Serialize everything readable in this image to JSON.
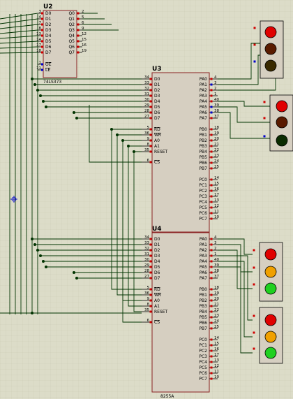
{
  "colors": {
    "background": "#dcdcc8",
    "grid": "#c9c9b3",
    "chip_fill": "#d6cfc1",
    "chip_border": "#8a2222",
    "wire": "#003300",
    "junction": "#003300",
    "pin_red": "#d00000",
    "pin_blue": "#0000cc",
    "led_red": "#e00000",
    "led_dark_red": "#5a1a00",
    "led_dark": "#3a2a00",
    "led_dark_green": "#0a2a00",
    "led_amber": "#f0a000",
    "led_green": "#20d020"
  },
  "components": {
    "u2": {
      "ref": "U2",
      "part": "74LS373",
      "left_pins": [
        {
          "num": "3",
          "name": "D0"
        },
        {
          "num": "4",
          "name": "D1"
        },
        {
          "num": "7",
          "name": "D2"
        },
        {
          "num": "8",
          "name": "D3"
        },
        {
          "num": "13",
          "name": "D4"
        },
        {
          "num": "14",
          "name": "D5"
        },
        {
          "num": "17",
          "name": "D6"
        },
        {
          "num": "18",
          "name": "D7"
        }
      ],
      "ctrl_pins": [
        {
          "num": "1",
          "name": "OE"
        },
        {
          "num": "11",
          "name": "LE"
        }
      ],
      "right_pins": [
        {
          "num": "2",
          "name": "Q0"
        },
        {
          "num": "5",
          "name": "Q1"
        },
        {
          "num": "6",
          "name": "Q2"
        },
        {
          "num": "9",
          "name": "Q3"
        },
        {
          "num": "12",
          "name": "Q4"
        },
        {
          "num": "15",
          "name": "Q5"
        },
        {
          "num": "16",
          "name": "Q6"
        },
        {
          "num": "19",
          "name": "Q7"
        }
      ]
    },
    "u3": {
      "ref": "U3",
      "part": "",
      "left_pins": [
        {
          "num": "34",
          "name": "D0"
        },
        {
          "num": "33",
          "name": "D1"
        },
        {
          "num": "32",
          "name": "D2"
        },
        {
          "num": "31",
          "name": "D3"
        },
        {
          "num": "30",
          "name": "D4"
        },
        {
          "num": "29",
          "name": "D5"
        },
        {
          "num": "28",
          "name": "D6"
        },
        {
          "num": "27",
          "name": "D7"
        }
      ],
      "ctrl_pins": [
        {
          "num": "5",
          "name": "RD"
        },
        {
          "num": "36",
          "name": "WR"
        },
        {
          "num": "9",
          "name": "A0"
        },
        {
          "num": "8",
          "name": "A1"
        },
        {
          "num": "35",
          "name": "RESET"
        }
      ],
      "cs_pin": {
        "num": "6",
        "name": "CS"
      },
      "pa": [
        {
          "num": "4",
          "name": "PA0"
        },
        {
          "num": "3",
          "name": "PA1"
        },
        {
          "num": "2",
          "name": "PA2"
        },
        {
          "num": "1",
          "name": "PA3"
        },
        {
          "num": "40",
          "name": "PA4"
        },
        {
          "num": "39",
          "name": "PA5"
        },
        {
          "num": "38",
          "name": "PA6"
        },
        {
          "num": "37",
          "name": "PA7"
        }
      ],
      "pb": [
        {
          "num": "18",
          "name": "PB0"
        },
        {
          "num": "19",
          "name": "PB1"
        },
        {
          "num": "20",
          "name": "PB2"
        },
        {
          "num": "21",
          "name": "PB3"
        },
        {
          "num": "22",
          "name": "PB4"
        },
        {
          "num": "23",
          "name": "PB5"
        },
        {
          "num": "24",
          "name": "PB6"
        },
        {
          "num": "25",
          "name": "PB7"
        }
      ],
      "pc": [
        {
          "num": "14",
          "name": "PC0"
        },
        {
          "num": "15",
          "name": "PC1"
        },
        {
          "num": "16",
          "name": "PC2"
        },
        {
          "num": "17",
          "name": "PC3"
        },
        {
          "num": "13",
          "name": "PC4"
        },
        {
          "num": "12",
          "name": "PC5"
        },
        {
          "num": "11",
          "name": "PC6"
        },
        {
          "num": "10",
          "name": "PC7"
        }
      ]
    },
    "u4": {
      "ref": "U4",
      "part": "8255A",
      "left_pins": [
        {
          "num": "34",
          "name": "D0"
        },
        {
          "num": "33",
          "name": "D1"
        },
        {
          "num": "32",
          "name": "D2"
        },
        {
          "num": "31",
          "name": "D3"
        },
        {
          "num": "30",
          "name": "D4"
        },
        {
          "num": "29",
          "name": "D5"
        },
        {
          "num": "28",
          "name": "D6"
        },
        {
          "num": "27",
          "name": "D7"
        }
      ],
      "ctrl_pins": [
        {
          "num": "5",
          "name": "RD"
        },
        {
          "num": "36",
          "name": "WR"
        },
        {
          "num": "9",
          "name": "A0"
        },
        {
          "num": "8",
          "name": "A1"
        },
        {
          "num": "35",
          "name": "RESET"
        }
      ],
      "cs_pin": {
        "num": "6",
        "name": "CS"
      },
      "pa": [
        {
          "num": "4",
          "name": "PA0"
        },
        {
          "num": "3",
          "name": "PA1"
        },
        {
          "num": "2",
          "name": "PA2"
        },
        {
          "num": "1",
          "name": "PA3"
        },
        {
          "num": "40",
          "name": "PA4"
        },
        {
          "num": "39",
          "name": "PA5"
        },
        {
          "num": "38",
          "name": "PA6"
        },
        {
          "num": "37",
          "name": "PA7"
        }
      ],
      "pb": [
        {
          "num": "18",
          "name": "PB0"
        },
        {
          "num": "19",
          "name": "PB1"
        },
        {
          "num": "20",
          "name": "PB2"
        },
        {
          "num": "21",
          "name": "PB3"
        },
        {
          "num": "22",
          "name": "PB4"
        },
        {
          "num": "23",
          "name": "PB5"
        },
        {
          "num": "24",
          "name": "PB6"
        },
        {
          "num": "25",
          "name": "PB7"
        }
      ],
      "pc": [
        {
          "num": "14",
          "name": "PC0"
        },
        {
          "num": "15",
          "name": "PC1"
        },
        {
          "num": "16",
          "name": "PC2"
        },
        {
          "num": "17",
          "name": "PC3"
        },
        {
          "num": "13",
          "name": "PC4"
        },
        {
          "num": "12",
          "name": "PC5"
        },
        {
          "num": "11",
          "name": "PC6"
        },
        {
          "num": "10",
          "name": "PC7"
        }
      ]
    }
  },
  "traffic_lights": [
    {
      "name": "light-1",
      "lamps": [
        "led_red",
        "led_dark_red",
        "led_dark"
      ]
    },
    {
      "name": "light-2",
      "lamps": [
        "led_red",
        "led_dark_red",
        "led_dark_green"
      ]
    },
    {
      "name": "light-3",
      "lamps": [
        "led_red",
        "led_amber",
        "led_green"
      ]
    },
    {
      "name": "light-4",
      "lamps": [
        "led_red",
        "led_amber",
        "led_green"
      ]
    }
  ]
}
